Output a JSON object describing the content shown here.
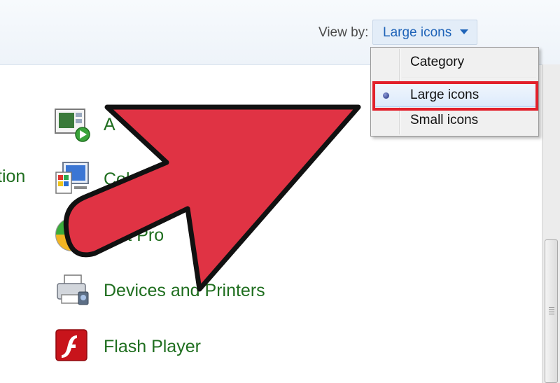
{
  "toolbar": {
    "view_by_label": "View by:",
    "view_by_value": "Large icons"
  },
  "left_panel": {
    "partial_text": "tion"
  },
  "items": [
    {
      "label": "A",
      "icon": "action-center-icon"
    },
    {
      "label": "Color",
      "icon": "color-management-icon"
    },
    {
      "label": "ault Pro",
      "icon": "default-programs-icon"
    },
    {
      "label": "Devices and Printers",
      "icon": "devices-printers-icon"
    },
    {
      "label": "Flash Player",
      "icon": "flash-player-icon"
    }
  ],
  "menu": {
    "options": [
      "Category",
      "Large icons",
      "Small icons"
    ],
    "selected": "Large icons"
  },
  "colors": {
    "link_green": "#1f6e1f",
    "accent_blue": "#1e63b8",
    "highlight_red": "#e2202b",
    "arrow_red": "#e03344"
  }
}
